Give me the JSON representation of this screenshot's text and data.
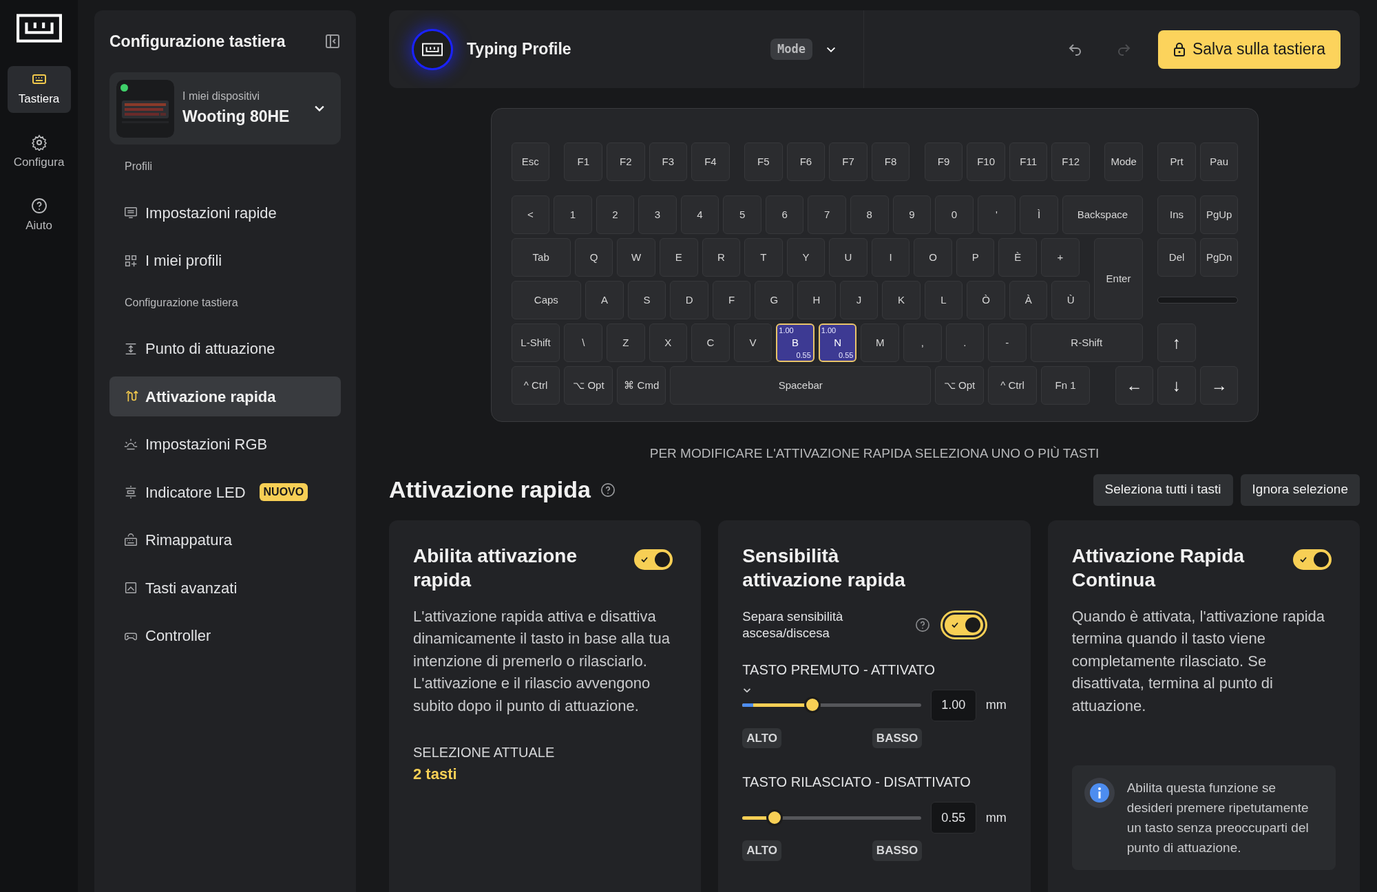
{
  "rail": {
    "items": [
      {
        "label": "Tastiera",
        "selected": true
      },
      {
        "label": "Configura",
        "selected": false
      },
      {
        "label": "Aiuto",
        "selected": false
      }
    ]
  },
  "sidebar": {
    "title": "Configurazione tastiera",
    "device": {
      "caption": "I miei dispositivi",
      "name": "Wooting 80HE",
      "connected": true
    },
    "sections": [
      {
        "label": "Profili",
        "items": [
          {
            "label": "Impostazioni rapide",
            "selected": false
          },
          {
            "label": "I miei profili",
            "selected": false
          }
        ]
      },
      {
        "label": "Configurazione tastiera",
        "items": [
          {
            "label": "Punto di attuazione",
            "selected": false
          },
          {
            "label": "Attivazione rapida",
            "selected": true
          },
          {
            "label": "Impostazioni RGB",
            "selected": false
          },
          {
            "label": "Indicatore LED",
            "selected": false,
            "badge": "NUOVO"
          },
          {
            "label": "Rimappatura",
            "selected": false
          },
          {
            "label": "Tasti avanzati",
            "selected": false
          },
          {
            "label": "Controller",
            "selected": false
          }
        ]
      }
    ]
  },
  "header": {
    "profile": "Typing Profile",
    "mode": "Mode",
    "history_buttons": [
      {
        "disabled": false
      },
      {
        "disabled": true
      }
    ],
    "save_button": "Salva sulla tastiera"
  },
  "keyboard": {
    "rows": [
      {
        "keys": [
          {
            "label": "Esc",
            "selected": false
          },
          {
            "label": "F1",
            "selected": false
          },
          {
            "label": "F2",
            "selected": false
          },
          {
            "label": "F3",
            "selected": false
          },
          {
            "label": "F4",
            "selected": false
          },
          {
            "label": "F5",
            "selected": false
          },
          {
            "label": "F6",
            "selected": false
          },
          {
            "label": "F7",
            "selected": false
          },
          {
            "label": "F8",
            "selected": false
          },
          {
            "label": "F9",
            "selected": false
          },
          {
            "label": "F10",
            "selected": false
          },
          {
            "label": "F11",
            "selected": false
          },
          {
            "label": "F12",
            "selected": false
          },
          {
            "label": "Mode",
            "selected": false
          },
          {
            "label": "Prt",
            "selected": false
          },
          {
            "label": "Pau",
            "selected": false
          }
        ]
      },
      {
        "keys": [
          {
            "label": "<",
            "selected": false
          },
          {
            "label": "1",
            "selected": false
          },
          {
            "label": "2",
            "selected": false
          },
          {
            "label": "3",
            "selected": false
          },
          {
            "label": "4",
            "selected": false
          },
          {
            "label": "5",
            "selected": false
          },
          {
            "label": "6",
            "selected": false
          },
          {
            "label": "7",
            "selected": false
          },
          {
            "label": "8",
            "selected": false
          },
          {
            "label": "9",
            "selected": false
          },
          {
            "label": "0",
            "selected": false
          },
          {
            "label": "'",
            "selected": false
          },
          {
            "label": "Ì",
            "selected": false
          },
          {
            "label": "Backspace",
            "selected": false
          },
          {
            "label": "Ins",
            "selected": false
          },
          {
            "label": "PgUp",
            "selected": false
          }
        ]
      },
      {
        "keys": [
          {
            "label": "Tab",
            "selected": false
          },
          {
            "label": "Q",
            "selected": false
          },
          {
            "label": "W",
            "selected": false
          },
          {
            "label": "E",
            "selected": false
          },
          {
            "label": "R",
            "selected": false
          },
          {
            "label": "T",
            "selected": false
          },
          {
            "label": "Y",
            "selected": false
          },
          {
            "label": "U",
            "selected": false
          },
          {
            "label": "I",
            "selected": false
          },
          {
            "label": "O",
            "selected": false
          },
          {
            "label": "P",
            "selected": false
          },
          {
            "label": "È",
            "selected": false
          },
          {
            "label": "+",
            "selected": false
          },
          {
            "label": "Enter",
            "selected": false
          },
          {
            "label": "Del",
            "selected": false
          },
          {
            "label": "PgDn",
            "selected": false
          }
        ]
      },
      {
        "keys": [
          {
            "label": "Caps",
            "selected": false
          },
          {
            "label": "A",
            "selected": false
          },
          {
            "label": "S",
            "selected": false
          },
          {
            "label": "D",
            "selected": false
          },
          {
            "label": "F",
            "selected": false
          },
          {
            "label": "G",
            "selected": false
          },
          {
            "label": "H",
            "selected": false
          },
          {
            "label": "J",
            "selected": false
          },
          {
            "label": "K",
            "selected": false
          },
          {
            "label": "L",
            "selected": false
          },
          {
            "label": "Ò",
            "selected": false
          },
          {
            "label": "À",
            "selected": false
          },
          {
            "label": "Ù",
            "selected": false
          }
        ]
      },
      {
        "keys": [
          {
            "label": "L-Shift",
            "selected": false
          },
          {
            "label": "\\",
            "selected": false
          },
          {
            "label": "Z",
            "selected": false
          },
          {
            "label": "X",
            "selected": false
          },
          {
            "label": "C",
            "selected": false
          },
          {
            "label": "V",
            "selected": false
          },
          {
            "label": "B",
            "selected": true,
            "press": "1.00",
            "release": "0.55"
          },
          {
            "label": "N",
            "selected": true,
            "press": "1.00",
            "release": "0.55"
          },
          {
            "label": "M",
            "selected": false
          },
          {
            "label": ",",
            "selected": false
          },
          {
            "label": ".",
            "selected": false
          },
          {
            "label": "-",
            "selected": false
          },
          {
            "label": "R-Shift",
            "selected": false
          },
          {
            "label": "↑",
            "selected": false
          }
        ]
      },
      {
        "keys": [
          {
            "label": "^ Ctrl",
            "selected": false
          },
          {
            "label": "⌥ Opt",
            "selected": false
          },
          {
            "label": "⌘ Cmd",
            "selected": false
          },
          {
            "label": "Spacebar",
            "selected": false
          },
          {
            "label": "⌥ Opt",
            "selected": false
          },
          {
            "label": "^ Ctrl",
            "selected": false
          },
          {
            "label": "Fn 1",
            "selected": false
          },
          {
            "label": "←",
            "selected": false
          },
          {
            "label": "↓",
            "selected": false
          },
          {
            "label": "→",
            "selected": false
          }
        ]
      }
    ]
  },
  "hint": "PER MODIFICARE L'ATTIVAZIONE RAPIDA SELEZIONA UNO O PIÙ TASTI",
  "section_title": "Attivazione rapida",
  "section_buttons": [
    "Seleziona tutti i tasti",
    "Ignora selezione"
  ],
  "cards": [
    {
      "kind": "description",
      "title": "Abilita attivazione rapida",
      "toggle": {
        "on": true
      },
      "text": "L'attivazione rapida attiva e disattiva dinamicamente il tasto in base alla tua intenzione di premerlo o rilasciarlo. L'attivazione e il rilascio avvengono subito dopo il punto di attuazione.",
      "selection_label": "SELEZIONE ATTUALE",
      "selection_value": "2 tasti"
    },
    {
      "kind": "sensitivity",
      "title": "Sensibilità attivazione rapida",
      "option": {
        "label": "Separa sensibilità ascesa/discesa",
        "toggle": {
          "on": true,
          "focused": true
        }
      },
      "sliders": [
        {
          "label": "TASTO PREMUTO - ATTIVATO",
          "dropdown": true,
          "level": 0.39,
          "value": "1.00",
          "unit": "mm",
          "low": "ALTO",
          "high": "BASSO"
        },
        {
          "label": "TASTO RILASCIATO - DISATTIVATO",
          "dropdown": false,
          "level": 0.18,
          "value": "0.55",
          "unit": "mm",
          "low": "ALTO",
          "high": "BASSO"
        }
      ]
    },
    {
      "kind": "info",
      "title": "Attivazione Rapida Continua",
      "toggle": {
        "on": true
      },
      "text": "Quando è attivata, l'attivazione rapida termina quando il tasto viene completamente rilasciato. Se disattivata, termina al punto di attuazione.",
      "note": "Abilita questa funzione se desideri premere ripetutamente un tasto senza preoccuparti del punto di attuazione."
    }
  ]
}
